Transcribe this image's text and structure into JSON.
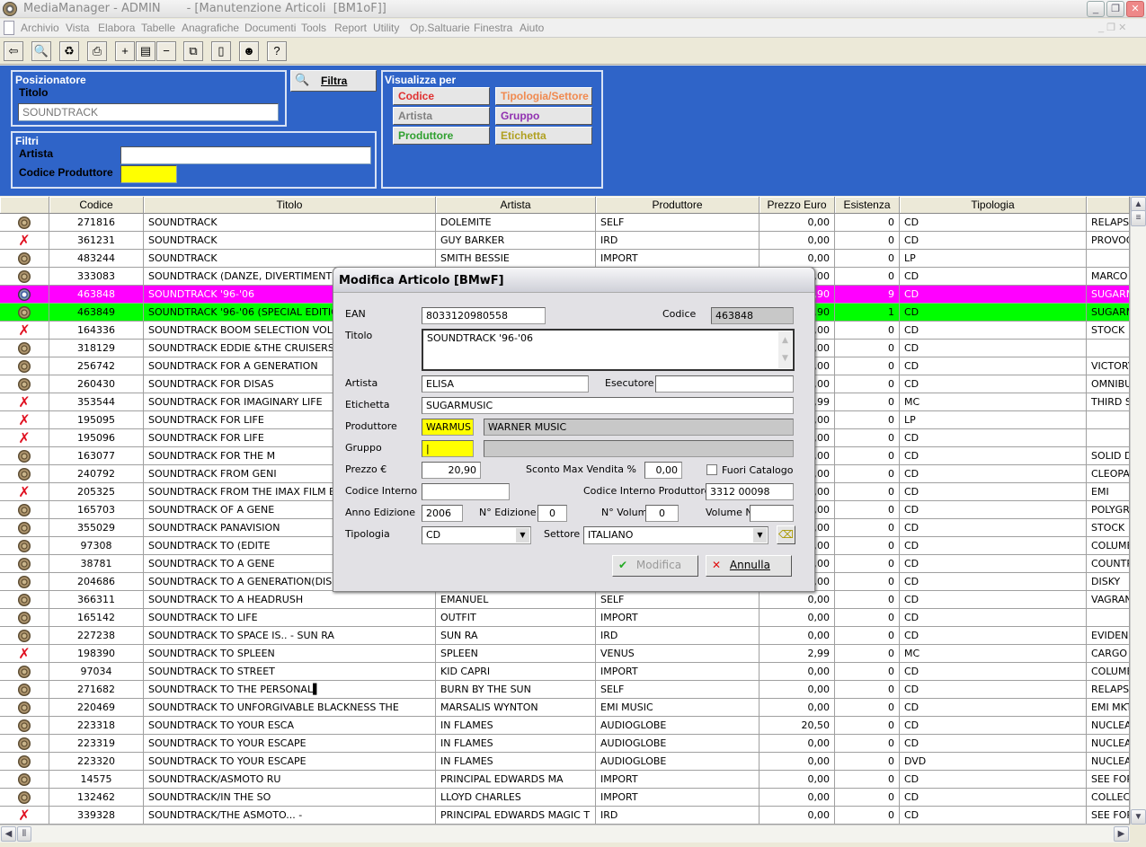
{
  "window": {
    "app_title": "MediaManager - ADMIN",
    "doc_title": "- [Manutenzione Articoli  [BM1oF]]"
  },
  "menu": [
    "Archivio",
    "Vista",
    "Elabora",
    "Tabelle",
    "Anagrafiche",
    "Documenti",
    "Tools",
    "Report",
    "Utility",
    "Op.Saltuarie",
    "Finestra",
    "Aiuto"
  ],
  "toolbar": [
    {
      "icon": "exit-icon",
      "glyph": "⇦"
    },
    {
      "icon": "search-icon",
      "glyph": "🔍"
    },
    {
      "icon": "refresh-icon",
      "glyph": "♻"
    },
    {
      "icon": "print-icon",
      "glyph": "⎙"
    },
    {
      "icon": "add-icon",
      "glyph": "+"
    },
    {
      "icon": "edit-icon",
      "glyph": "▤"
    },
    {
      "icon": "remove-icon",
      "glyph": "−"
    },
    {
      "icon": "copy-icon",
      "glyph": "⧉"
    },
    {
      "icon": "document-icon",
      "glyph": "▯"
    },
    {
      "icon": "user-icon",
      "glyph": "☻"
    },
    {
      "icon": "help-icon",
      "glyph": "?"
    }
  ],
  "positioner": {
    "title": "Posizionatore",
    "field_label": "Titolo",
    "value": "SOUNDTRACK"
  },
  "filter_button": "Filtra",
  "filters": {
    "title": "Filtri",
    "artista_label": "Artista",
    "artista_value": "",
    "codprod_label": "Codice Produttore",
    "codprod_value": ""
  },
  "view_by": {
    "title": "Visualizza per",
    "buttons": [
      {
        "label": "Codice",
        "color": "#e03030"
      },
      {
        "label": "Tipologia/Settore",
        "color": "#f08a50"
      },
      {
        "label": "Artista",
        "color": "#808080"
      },
      {
        "label": "Gruppo",
        "color": "#9030b0"
      },
      {
        "label": "Produttore",
        "color": "#30a030"
      },
      {
        "label": "Etichetta",
        "color": "#b0a020"
      }
    ]
  },
  "table": {
    "columns": [
      "",
      "Codice",
      "Titolo",
      "Artista",
      "Produttore",
      "Prezzo Euro",
      "Esistenza",
      "Tipologia",
      ""
    ],
    "highlight_colors": {
      "selected": "#ff00ff",
      "related": "#00ff00"
    },
    "rows": [
      [
        "cd",
        "271816",
        "SOUNDTRACK",
        "DOLEMITE",
        "SELF",
        "0,00",
        "0",
        "CD",
        "RELAPS",
        ""
      ],
      [
        "x",
        "361231",
        "SOUNDTRACK",
        "GUY BARKER",
        "IRD",
        "0,00",
        "0",
        "CD",
        "PROVOC",
        ""
      ],
      [
        "cd",
        "483244",
        "SOUNDTRACK",
        "SMITH BESSIE",
        "IMPORT",
        "0,00",
        "0",
        "LP",
        "",
        ""
      ],
      [
        "cd",
        "333083",
        "SOUNDTRACK (DANZE, DIVERTIMENTI",
        "",
        "",
        "0,00",
        "0",
        "CD",
        "MARCO",
        ""
      ],
      [
        "sel",
        "463848",
        "SOUNDTRACK '96-'06",
        "",
        "",
        "20,90",
        "9",
        "CD",
        "SUGARM",
        "selected"
      ],
      [
        "cd",
        "463849",
        "SOUNDTRACK '96-'06  (SPECIAL EDITION",
        "",
        "",
        "5,90",
        "1",
        "CD",
        "SUGARM",
        "related"
      ],
      [
        "x",
        "164336",
        "SOUNDTRACK BOOM SELECTION VOL.2",
        "",
        "",
        "0,00",
        "0",
        "CD",
        "STOCK",
        ""
      ],
      [
        "cd",
        "318129",
        "SOUNDTRACK EDDIE &THE CRUISERS",
        "",
        "",
        "0,00",
        "0",
        "CD",
        "",
        ""
      ],
      [
        "cd",
        "256742",
        "SOUNDTRACK FOR A GENERATION",
        "",
        "",
        "0,00",
        "0",
        "CD",
        "VICTORY",
        ""
      ],
      [
        "cd",
        "260430",
        "SOUNDTRACK FOR DISAS",
        "",
        "",
        "0,00",
        "0",
        "CD",
        "OMNIBU",
        ""
      ],
      [
        "x",
        "353544",
        "SOUNDTRACK FOR IMAGINARY LIFE",
        "",
        "",
        "2,99",
        "0",
        "MC",
        "THIRD S",
        ""
      ],
      [
        "x",
        "195095",
        "SOUNDTRACK FOR LIFE",
        "",
        "",
        "0,00",
        "0",
        "LP",
        "",
        ""
      ],
      [
        "x",
        "195096",
        "SOUNDTRACK FOR LIFE",
        "",
        "",
        "0,00",
        "0",
        "CD",
        "",
        ""
      ],
      [
        "cd",
        "163077",
        "SOUNDTRACK FOR THE M",
        "",
        "",
        "0,00",
        "0",
        "CD",
        "SOLID D",
        ""
      ],
      [
        "cd",
        "240792",
        "SOUNDTRACK FROM GENI",
        "",
        "",
        "0,00",
        "0",
        "CD",
        "CLEOPA",
        ""
      ],
      [
        "x",
        "205325",
        "SOUNDTRACK FROM THE IMAX FILM EV",
        "",
        "",
        "0,00",
        "0",
        "CD",
        "EMI",
        ""
      ],
      [
        "cd",
        "165703",
        "SOUNDTRACK OF A GENE",
        "",
        "",
        "0,00",
        "0",
        "CD",
        "POLYGR",
        ""
      ],
      [
        "cd",
        "355029",
        "SOUNDTRACK PANAVISION",
        "",
        "",
        "0,00",
        "0",
        "CD",
        "STOCK",
        ""
      ],
      [
        "cd",
        "97308",
        "SOUNDTRACK TO (EDITE",
        "",
        "",
        "0,00",
        "0",
        "CD",
        "COLUME",
        ""
      ],
      [
        "cd",
        "38781",
        "SOUNDTRACK TO A GENE",
        "",
        "",
        "0,00",
        "0",
        "CD",
        "COUNTR",
        ""
      ],
      [
        "cd",
        "204686",
        "SOUNDTRACK TO A GENERATION(DISK",
        "",
        "",
        "0,00",
        "0",
        "CD",
        "DISKY",
        ""
      ],
      [
        "cd",
        "366311",
        "SOUNDTRACK TO A HEADRUSH",
        "EMANUEL",
        "SELF",
        "0,00",
        "0",
        "CD",
        "VAGRAN",
        ""
      ],
      [
        "cd",
        "165142",
        "SOUNDTRACK TO LIFE",
        "OUTFIT",
        "IMPORT",
        "0,00",
        "0",
        "CD",
        "",
        ""
      ],
      [
        "cd",
        "227238",
        "SOUNDTRACK TO SPACE IS.. - SUN RA",
        "SUN RA",
        "IRD",
        "0,00",
        "0",
        "CD",
        "EVIDENC",
        ""
      ],
      [
        "x",
        "198390",
        "SOUNDTRACK TO SPLEEN",
        "SPLEEN",
        "VENUS",
        "2,99",
        "0",
        "MC",
        "CARGO",
        ""
      ],
      [
        "cd",
        "97034",
        "SOUNDTRACK TO STREET",
        "KID CAPRI",
        "IMPORT",
        "0,00",
        "0",
        "CD",
        "COLUME",
        ""
      ],
      [
        "cd",
        "271682",
        "SOUNDTRACK TO THE PERSONAL▌",
        "BURN BY THE SUN",
        "SELF",
        "0,00",
        "0",
        "CD",
        "RELAPS",
        ""
      ],
      [
        "cd",
        "220469",
        "SOUNDTRACK TO UNFORGIVABLE BLACKNESS THE",
        "MARSALIS WYNTON",
        "EMI MUSIC",
        "0,00",
        "0",
        "CD",
        "EMI MKT",
        ""
      ],
      [
        "cd",
        "223318",
        "SOUNDTRACK TO YOUR ESCA",
        "IN FLAMES",
        "AUDIOGLOBE",
        "20,50",
        "0",
        "CD",
        "NUCLEA",
        ""
      ],
      [
        "cd",
        "223319",
        "SOUNDTRACK TO YOUR ESCAPE",
        "IN FLAMES",
        "AUDIOGLOBE",
        "0,00",
        "0",
        "CD",
        "NUCLEA",
        ""
      ],
      [
        "cd",
        "223320",
        "SOUNDTRACK TO YOUR ESCAPE",
        "IN FLAMES",
        "AUDIOGLOBE",
        "0,00",
        "0",
        "DVD",
        "NUCLEA",
        ""
      ],
      [
        "cd",
        "14575",
        "SOUNDTRACK/ASMOTO RU",
        "PRINCIPAL EDWARDS MA",
        "IMPORT",
        "0,00",
        "0",
        "CD",
        "SEE FOR",
        ""
      ],
      [
        "cd",
        "132462",
        "SOUNDTRACK/IN THE SO",
        "LLOYD CHARLES",
        "IMPORT",
        "0,00",
        "0",
        "CD",
        "COLLECT",
        ""
      ],
      [
        "x",
        "339328",
        "SOUNDTRACK/THE ASMOTO... -",
        "PRINCIPAL EDWARDS MAGIC T",
        "IRD",
        "0,00",
        "0",
        "CD",
        "SEE FOR",
        ""
      ]
    ]
  },
  "dialog": {
    "title": "Modifica Articolo  [BMwF]",
    "ean_label": "EAN",
    "ean": "8033120980558",
    "codice_label": "Codice",
    "codice": "463848",
    "titolo_label": "Titolo",
    "titolo": "SOUNDTRACK '96-'06",
    "artista_label": "Artista",
    "artista": "ELISA",
    "esecutore_label": "Esecutore",
    "esecutore": "",
    "etichetta_label": "Etichetta",
    "etichetta": "SUGARMUSIC",
    "produttore_label": "Produttore",
    "produttore_code": "WARMUS",
    "produttore_name": "WARNER MUSIC",
    "gruppo_label": "Gruppo",
    "gruppo_code": "|",
    "gruppo_name": "",
    "prezzo_label": "Prezzo €",
    "prezzo": "20,90",
    "sconto_label": "Sconto Max Vendita %",
    "sconto": "0,00",
    "fuori_catalogo_label": "Fuori Catalogo",
    "fuori_catalogo": false,
    "codint_label": "Codice Interno",
    "codint": "",
    "codintprod_label": "Codice Interno Produttore",
    "codintprod": "3312 00098",
    "anno_label": "Anno Edizione",
    "anno": "2006",
    "nedizione_label": "N° Edizione",
    "nedizione": "0",
    "nvolumi_label": "N° Volumi",
    "nvolumi": "0",
    "volume_label": "Volume N°",
    "volume": "",
    "tipologia_label": "Tipologia",
    "tipologia": "CD",
    "settore_label": "Settore",
    "settore": "ITALIANO",
    "modifica_label": "Modifica",
    "annulla_label": "Annulla"
  }
}
